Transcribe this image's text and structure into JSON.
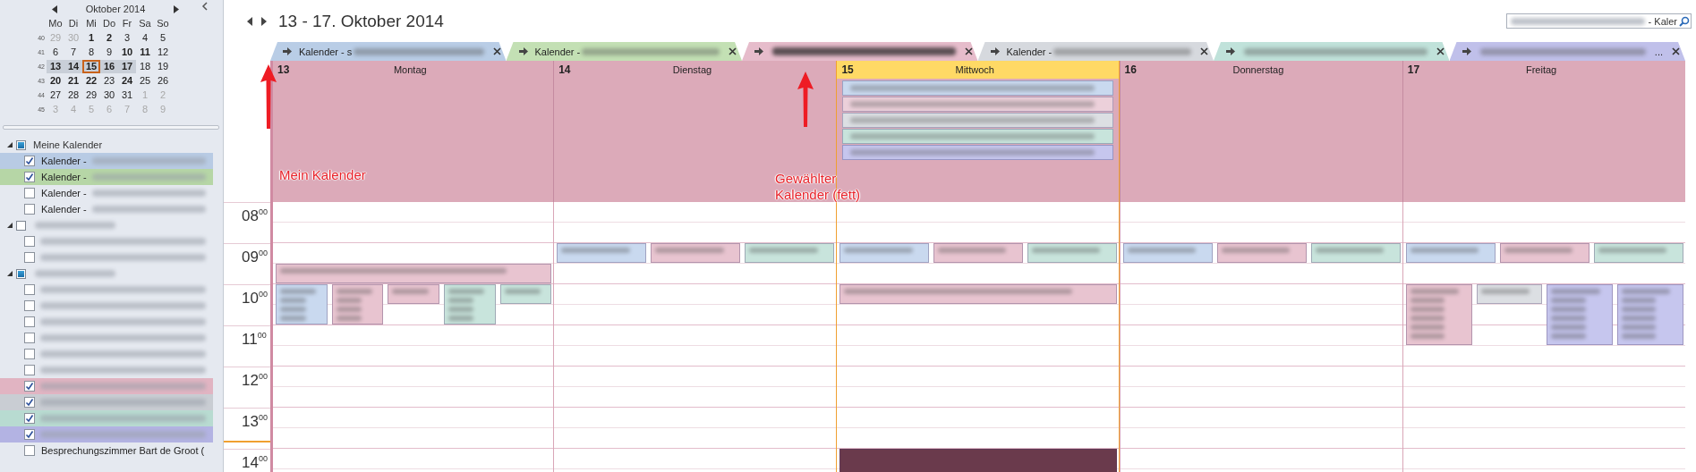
{
  "mini_calendar": {
    "month": "Oktober 2014",
    "weekdays": [
      "Mo",
      "Di",
      "Mi",
      "Do",
      "Fr",
      "Sa",
      "So"
    ],
    "weeks": [
      {
        "number": "40",
        "days": [
          {
            "text": "29",
            "other_month": true,
            "bold": false,
            "selected": false,
            "today": false
          },
          {
            "text": "30",
            "other_month": true,
            "bold": false,
            "selected": false,
            "today": false
          },
          {
            "text": "1",
            "other_month": false,
            "bold": true,
            "selected": false,
            "today": false
          },
          {
            "text": "2",
            "other_month": false,
            "bold": true,
            "selected": false,
            "today": false
          },
          {
            "text": "3",
            "other_month": false,
            "bold": false,
            "selected": false,
            "today": false
          },
          {
            "text": "4",
            "other_month": false,
            "bold": false,
            "selected": false,
            "today": false
          },
          {
            "text": "5",
            "other_month": false,
            "bold": false,
            "selected": false,
            "today": false
          }
        ]
      },
      {
        "number": "41",
        "days": [
          {
            "text": "6",
            "other_month": false,
            "bold": false,
            "selected": false,
            "today": false
          },
          {
            "text": "7",
            "other_month": false,
            "bold": false,
            "selected": false,
            "today": false
          },
          {
            "text": "8",
            "other_month": false,
            "bold": false,
            "selected": false,
            "today": false
          },
          {
            "text": "9",
            "other_month": false,
            "bold": false,
            "selected": false,
            "today": false
          },
          {
            "text": "10",
            "other_month": false,
            "bold": true,
            "selected": false,
            "today": false
          },
          {
            "text": "11",
            "other_month": false,
            "bold": true,
            "selected": false,
            "today": false
          },
          {
            "text": "12",
            "other_month": false,
            "bold": false,
            "selected": false,
            "today": false
          }
        ]
      },
      {
        "number": "42",
        "days": [
          {
            "text": "13",
            "other_month": false,
            "bold": true,
            "selected": true,
            "today": false
          },
          {
            "text": "14",
            "other_month": false,
            "bold": true,
            "selected": true,
            "today": false
          },
          {
            "text": "15",
            "other_month": false,
            "bold": true,
            "selected": true,
            "today": true
          },
          {
            "text": "16",
            "other_month": false,
            "bold": true,
            "selected": true,
            "today": false
          },
          {
            "text": "17",
            "other_month": false,
            "bold": true,
            "selected": true,
            "today": false
          },
          {
            "text": "18",
            "other_month": false,
            "bold": false,
            "selected": false,
            "today": false
          },
          {
            "text": "19",
            "other_month": false,
            "bold": false,
            "selected": false,
            "today": false
          }
        ]
      },
      {
        "number": "43",
        "days": [
          {
            "text": "20",
            "other_month": false,
            "bold": true,
            "selected": false,
            "today": false
          },
          {
            "text": "21",
            "other_month": false,
            "bold": true,
            "selected": false,
            "today": false
          },
          {
            "text": "22",
            "other_month": false,
            "bold": true,
            "selected": false,
            "today": false
          },
          {
            "text": "23",
            "other_month": false,
            "bold": false,
            "selected": false,
            "today": false
          },
          {
            "text": "24",
            "other_month": false,
            "bold": true,
            "selected": false,
            "today": false
          },
          {
            "text": "25",
            "other_month": false,
            "bold": false,
            "selected": false,
            "today": false
          },
          {
            "text": "26",
            "other_month": false,
            "bold": false,
            "selected": false,
            "today": false
          }
        ]
      },
      {
        "number": "44",
        "days": [
          {
            "text": "27",
            "other_month": false,
            "bold": false,
            "selected": false,
            "today": false
          },
          {
            "text": "28",
            "other_month": false,
            "bold": false,
            "selected": false,
            "today": false
          },
          {
            "text": "29",
            "other_month": false,
            "bold": false,
            "selected": false,
            "today": false
          },
          {
            "text": "30",
            "other_month": false,
            "bold": false,
            "selected": false,
            "today": false
          },
          {
            "text": "31",
            "other_month": false,
            "bold": false,
            "selected": false,
            "today": false
          },
          {
            "text": "1",
            "other_month": true,
            "bold": false,
            "selected": false,
            "today": false
          },
          {
            "text": "2",
            "other_month": true,
            "bold": false,
            "selected": false,
            "today": false
          }
        ]
      },
      {
        "number": "45",
        "days": [
          {
            "text": "3",
            "other_month": true,
            "bold": false,
            "selected": false,
            "today": false
          },
          {
            "text": "4",
            "other_month": true,
            "bold": false,
            "selected": false,
            "today": false
          },
          {
            "text": "5",
            "other_month": true,
            "bold": false,
            "selected": false,
            "today": false
          },
          {
            "text": "6",
            "other_month": true,
            "bold": false,
            "selected": false,
            "today": false
          },
          {
            "text": "7",
            "other_month": true,
            "bold": false,
            "selected": false,
            "today": false
          },
          {
            "text": "8",
            "other_month": true,
            "bold": false,
            "selected": false,
            "today": false
          },
          {
            "text": "9",
            "other_month": true,
            "bold": false,
            "selected": false,
            "today": false
          }
        ]
      }
    ]
  },
  "calendar_groups": [
    {
      "label": "Meine Kalender",
      "expanded": true,
      "checked": true,
      "items": [
        {
          "label": "Kalender -",
          "checked": true,
          "color": "#b8cbe4"
        },
        {
          "label": "Kalender -",
          "checked": true,
          "color": "#b6d6a6"
        },
        {
          "label": "Kalender -",
          "checked": false
        },
        {
          "label": "Kalender -",
          "checked": false
        }
      ]
    },
    {
      "expanded": true,
      "checked": false,
      "items": [
        {
          "checked": false
        },
        {
          "checked": false
        }
      ]
    },
    {
      "expanded": true,
      "checked": true,
      "items": [
        {
          "checked": false
        },
        {
          "checked": false
        },
        {
          "checked": false
        },
        {
          "checked": false
        },
        {
          "checked": false
        },
        {
          "checked": false
        },
        {
          "checked": true,
          "color": "#e1b4c2"
        },
        {
          "checked": true,
          "color": "#c9cdd3"
        },
        {
          "checked": true,
          "color": "#b8dbd1"
        },
        {
          "checked": true,
          "color": "#b3b3e3"
        },
        {
          "label": "Besprechungszimmer Bart de Groot (",
          "checked": false
        }
      ]
    }
  ],
  "header": {
    "title": "13 - 17. Oktober 2014",
    "search": {
      "value": "- Kaler"
    }
  },
  "tabs": [
    {
      "label": "Kalender - s",
      "color": "#b9cde6",
      "selected": false
    },
    {
      "label": "Kalender -",
      "color": "#c3e0b4",
      "selected": false
    },
    {
      "color": "#e6bccb",
      "selected": true
    },
    {
      "label": "Kalender -",
      "color": "#d6d9de",
      "selected": false
    },
    {
      "color": "#c0e2da",
      "selected": false
    },
    {
      "color": "#c0c0ea",
      "selected": false,
      "trailing": "..."
    }
  ],
  "days": [
    {
      "number": "13",
      "name": "Montag",
      "selected": false,
      "events": [
        {
          "color": "#e8c4d0"
        },
        {
          "color": "#c9d9ef"
        },
        {
          "color": "#e8c4d0"
        },
        {
          "color": "#e8c4d0"
        },
        {
          "color": "#c8e4dc"
        },
        {
          "color": "#c8e4dc"
        }
      ]
    },
    {
      "number": "14",
      "name": "Dienstag",
      "selected": false,
      "events": [
        {
          "color": "#c9d9ef"
        },
        {
          "color": "#e8c4d0"
        },
        {
          "color": "#c8e4dc"
        }
      ]
    },
    {
      "number": "15",
      "name": "Mittwoch",
      "selected": true,
      "all_day_events": [
        {
          "color": "#c9d9ef"
        },
        {
          "color": "#ecd0da"
        },
        {
          "color": "#dcdfe3"
        },
        {
          "color": "#c8e4dc"
        },
        {
          "color": "#c6c6ee"
        }
      ],
      "events": [
        {
          "color": "#c9d9ef"
        },
        {
          "color": "#e8c4d0"
        },
        {
          "color": "#c8e4dc"
        },
        {
          "color": "#e8c4d0"
        },
        {
          "color": "#6a3a4c"
        }
      ]
    },
    {
      "number": "16",
      "name": "Donnerstag",
      "selected": false,
      "events": [
        {
          "color": "#c9d9ef"
        },
        {
          "color": "#e8c4d0"
        },
        {
          "color": "#c8e4dc"
        }
      ]
    },
    {
      "number": "17",
      "name": "Freitag",
      "selected": false,
      "events": [
        {
          "color": "#c9d9ef"
        },
        {
          "color": "#e8c4d0"
        },
        {
          "color": "#c8e4dc"
        },
        {
          "color": "#e8c4d0"
        },
        {
          "color": "#dcdfe3"
        },
        {
          "color": "#c6c6ee"
        },
        {
          "color": "#c6c6ee"
        }
      ]
    }
  ],
  "hours": [
    "08$^{00}$",
    "09$^{00}$",
    "10$^{00}$",
    "11$^{00}$",
    "12$^{00}$",
    "13$^{00}$",
    "14$^{00}$"
  ],
  "annotations": [
    {
      "text": "Mein Kalender"
    },
    {
      "text": "Gewählter Kalender (fett)"
    }
  ]
}
